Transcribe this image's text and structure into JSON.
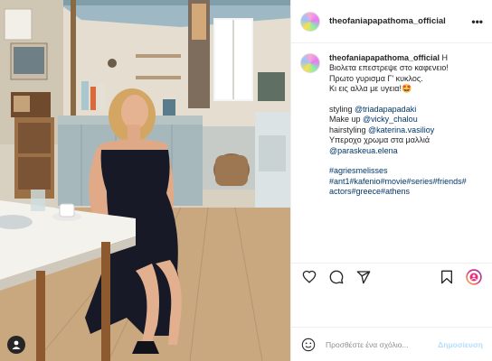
{
  "post": {
    "username": "theofaniapapathoma_official"
  },
  "caption": {
    "username": "theofaniapapathoma_official",
    "first_line_rest": "Η",
    "lines": [
      "Βιολετα επεστρεψε στο καφενειο!",
      "Πρωτο γυρισμα Γ' κυκλος.",
      "Κι εις αλλα με υγεια!🤩"
    ],
    "credits": [
      {
        "label": "styling ",
        "handle": "@triadapapadaki"
      },
      {
        "label": "Make up ",
        "handle": "@vicky_chalou"
      },
      {
        "label": "hairstyling ",
        "handle": "@katerina.vasilioy"
      },
      {
        "label": "Υπεροχο χρωμα στα μαλλιά",
        "handle": ""
      },
      {
        "label": "",
        "handle": "@paraskeua.elena"
      }
    ],
    "hashtag_lines": [
      "#agriesmelisses",
      "#ant1#kafenio#movie#series#friends#",
      "actors#greece#athens"
    ]
  },
  "icons": {
    "more": "more-horizontal-icon",
    "like": "heart-icon",
    "comment": "comment-icon",
    "share": "send-icon",
    "save": "bookmark-icon",
    "emoji": "emoji-icon",
    "tagged_user": "user-tag-icon"
  },
  "comment_box": {
    "placeholder": "Προσθέστε ένα σχόλιο...",
    "post_label": "Δημοσίευση"
  },
  "colors": {
    "link": "#00376b",
    "post_button": "#b2dffc",
    "border": "#efefef"
  }
}
